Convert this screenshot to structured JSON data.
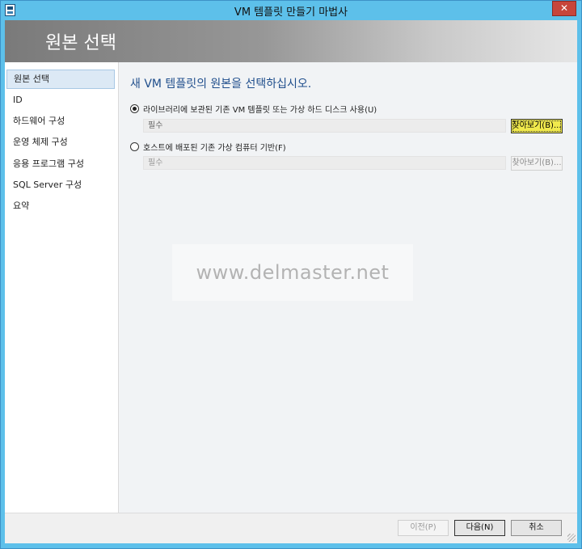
{
  "window": {
    "title": "VM 템플릿 만들기 마법사",
    "close_icon": "close-icon"
  },
  "banner": {
    "title": "원본 선택"
  },
  "sidebar": {
    "items": [
      {
        "label": "원본 선택",
        "active": true
      },
      {
        "label": "ID",
        "active": false
      },
      {
        "label": "하드웨어 구성",
        "active": false
      },
      {
        "label": "운영 체제 구성",
        "active": false
      },
      {
        "label": "응용 프로그램 구성",
        "active": false
      },
      {
        "label": "SQL Server 구성",
        "active": false
      },
      {
        "label": "요약",
        "active": false
      }
    ]
  },
  "main": {
    "heading": "새 VM 템플릿의 원본을 선택하십시오.",
    "option1": {
      "label": "라이브러리에 보관된 기존 VM 템플릿 또는 가상 하드 디스크 사용(U)",
      "checked": true,
      "input_value": "필수",
      "browse_label": "찾아보기(B)..."
    },
    "option2": {
      "label": "호스트에 배포된 기존 가상 컴퓨터 기반(F)",
      "checked": false,
      "input_value": "필수",
      "browse_label": "찾아보기(B)..."
    }
  },
  "watermark": {
    "text": "www.delmaster.net"
  },
  "footer": {
    "back_label": "이전(P)",
    "next_label": "다음(N)",
    "cancel_label": "취소"
  },
  "colors": {
    "titlebar": "#5dc0ea",
    "heading": "#1f4e8c",
    "active_browse": "#f0e94c",
    "close": "#c7453b"
  }
}
